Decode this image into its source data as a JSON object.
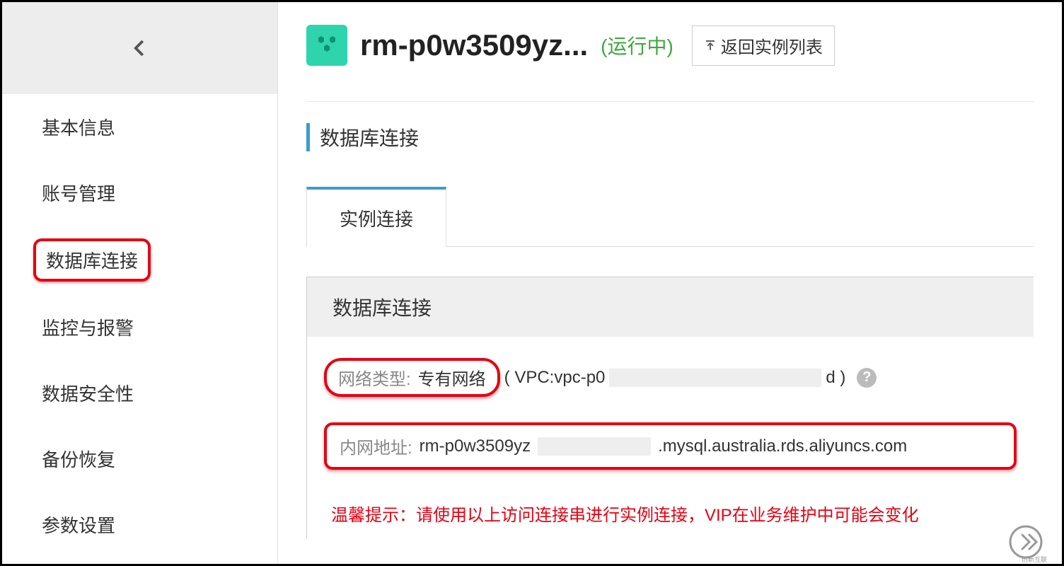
{
  "sidebar": {
    "items": [
      {
        "label": "基本信息"
      },
      {
        "label": "账号管理"
      },
      {
        "label": "数据库连接"
      },
      {
        "label": "监控与报警"
      },
      {
        "label": "数据安全性"
      },
      {
        "label": "备份恢复"
      },
      {
        "label": "参数设置"
      }
    ]
  },
  "header": {
    "title": "rm-p0w3509yz...",
    "status": "(运行中)",
    "back_button": "返回实例列表"
  },
  "section": {
    "title": "数据库连接"
  },
  "tabs": {
    "tab1": "实例连接"
  },
  "panel": {
    "header": "数据库连接",
    "network_type_label": "网络类型:",
    "network_type_value": "专有网络",
    "vpc_prefix": "( VPC:vpc-p0",
    "vpc_suffix": "d )",
    "intranet_label": "内网地址:",
    "intranet_prefix": "rm-p0w3509yz",
    "intranet_suffix": ".mysql.australia.rds.aliyuncs.com",
    "warning": "温馨提示：请使用以上访问连接串进行实例连接，VIP在业务维护中可能会变化"
  }
}
